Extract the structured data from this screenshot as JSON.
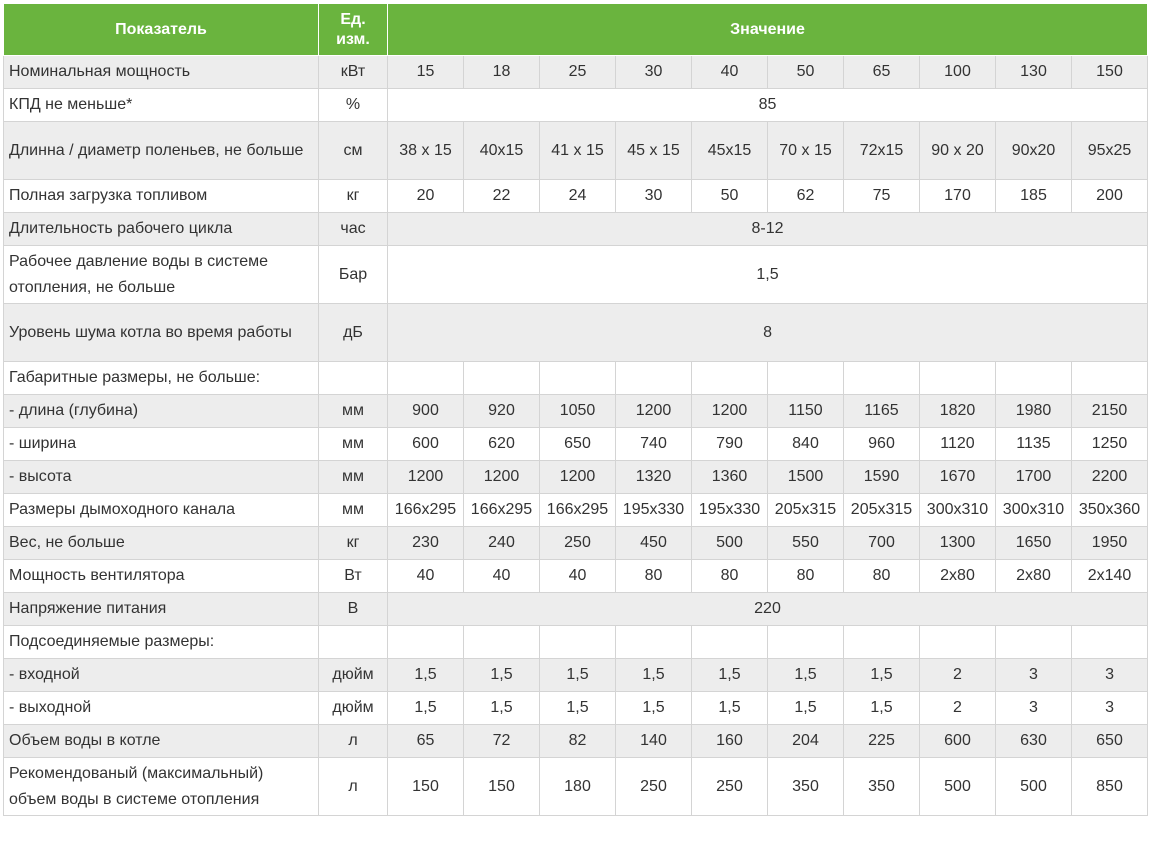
{
  "table": {
    "headers": {
      "param": "Показатель",
      "unit": "Ед. изм.",
      "value": "Значение"
    },
    "rows": [
      {
        "param": "Номинальная мощность",
        "unit": "кВт",
        "values": [
          "15",
          "18",
          "25",
          "30",
          "40",
          "50",
          "65",
          "100",
          "130",
          "150"
        ]
      },
      {
        "param": "КПД не меньше*",
        "unit": "%",
        "merged": "85"
      },
      {
        "param": "Длинна / диаметр поленьев, не больше",
        "unit": "см",
        "values": [
          "38 х 15",
          "40x15",
          "41 х 15",
          "45 х 15",
          "45x15",
          "70 х 15",
          "72x15",
          "90 х 20",
          "90x20",
          "95x25"
        ]
      },
      {
        "param": "Полная загрузка топливом",
        "unit": "кг",
        "values": [
          "20",
          "22",
          "24",
          "30",
          "50",
          "62",
          "75",
          "170",
          "185",
          "200"
        ]
      },
      {
        "param": "Длительность рабочего цикла",
        "unit": "час",
        "merged": "8-12"
      },
      {
        "param": "Рабочее давление воды в системе отопления, не больше",
        "unit": "Бар",
        "merged": "1,5"
      },
      {
        "param": "Уровень шума котла во время работы",
        "unit": "дБ",
        "merged": "8"
      },
      {
        "param": "Габаритные размеры, не больше:",
        "unit": "",
        "values": [
          "",
          "",
          "",
          "",
          "",
          "",
          "",
          "",
          "",
          ""
        ]
      },
      {
        "param": "- длина (глубина)",
        "unit": "мм",
        "values": [
          "900",
          "920",
          "1050",
          "1200",
          "1200",
          "1150",
          "1165",
          "1820",
          "1980",
          "2150"
        ]
      },
      {
        "param": "- ширина",
        "unit": "мм",
        "values": [
          "600",
          "620",
          "650",
          "740",
          "790",
          "840",
          "960",
          "1120",
          "1135",
          "1250"
        ]
      },
      {
        "param": "- высота",
        "unit": "мм",
        "values": [
          "1200",
          "1200",
          "1200",
          "1320",
          "1360",
          "1500",
          "1590",
          "1670",
          "1700",
          "2200"
        ]
      },
      {
        "param": "Размеры дымоходного канала",
        "unit": "мм",
        "values": [
          "166x295",
          "166x295",
          "166x295",
          "195x330",
          "195x330",
          "205x315",
          "205x315",
          "300x310",
          "300x310",
          "350x360"
        ]
      },
      {
        "param": "Вес, не больше",
        "unit": "кг",
        "values": [
          "230",
          "240",
          "250",
          "450",
          "500",
          "550",
          "700",
          "1300",
          "1650",
          "1950"
        ]
      },
      {
        "param": "Мощность вентилятора",
        "unit": "Вт",
        "values": [
          "40",
          "40",
          "40",
          "80",
          "80",
          "80",
          "80",
          "2x80",
          "2x80",
          "2x140"
        ]
      },
      {
        "param": "Напряжение питания",
        "unit": "В",
        "merged": "220"
      },
      {
        "param": "Подсоединяемые размеры:",
        "unit": "",
        "values": [
          "",
          "",
          "",
          "",
          "",
          "",
          "",
          "",
          "",
          ""
        ]
      },
      {
        "param": "- входной",
        "unit": "дюйм",
        "values": [
          "1,5",
          "1,5",
          "1,5",
          "1,5",
          "1,5",
          "1,5",
          "1,5",
          "2",
          "3",
          "3"
        ]
      },
      {
        "param": "- выходной",
        "unit": "дюйм",
        "values": [
          "1,5",
          "1,5",
          "1,5",
          "1,5",
          "1,5",
          "1,5",
          "1,5",
          "2",
          "3",
          "3"
        ]
      },
      {
        "param": "Объем воды в котле",
        "unit": "л",
        "values": [
          "65",
          "72",
          "82",
          "140",
          "160",
          "204",
          "225",
          "600",
          "630",
          "650"
        ]
      },
      {
        "param": "Рекомендованый (максимальный) объем воды в системе отопления",
        "unit": "л",
        "values": [
          "150",
          "150",
          "180",
          "250",
          "250",
          "350",
          "350",
          "500",
          "500",
          "850"
        ]
      }
    ]
  }
}
